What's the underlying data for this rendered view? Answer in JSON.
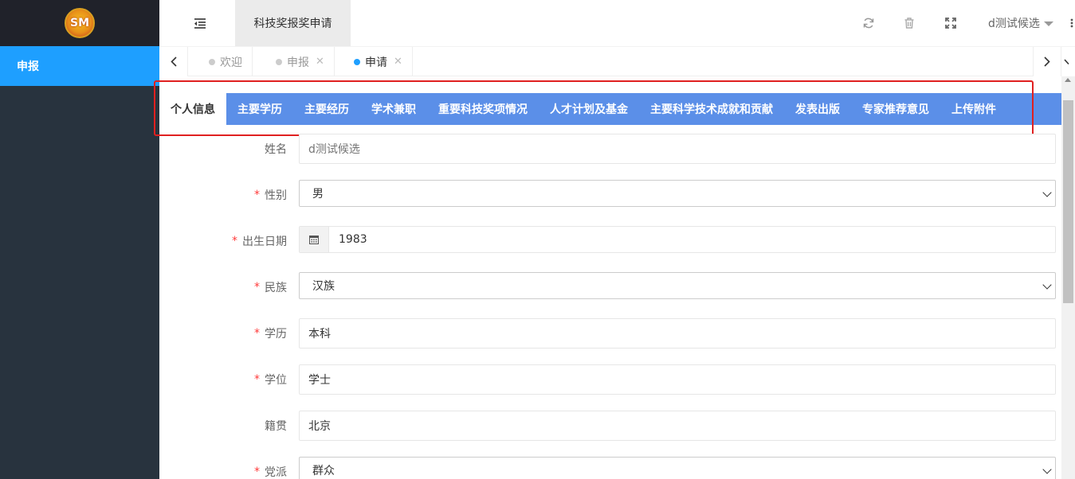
{
  "sidebar": {
    "logo_text": "SM",
    "items": [
      {
        "label": "申报"
      }
    ]
  },
  "header": {
    "title": "科技奖报奖申请",
    "user_name": "d测试候选",
    "icons": [
      "menu-fold-icon",
      "refresh-icon",
      "trash-icon",
      "fullscreen-icon",
      "more-vertical-icon"
    ]
  },
  "tabbar": {
    "tabs": [
      {
        "label": "欢迎",
        "closable": false,
        "active": false
      },
      {
        "label": "申报",
        "closable": true,
        "active": false
      },
      {
        "label": "申请",
        "closable": true,
        "active": true
      }
    ]
  },
  "content_tabs": [
    {
      "label": "个人信息",
      "active": true
    },
    {
      "label": "主要学历"
    },
    {
      "label": "主要经历"
    },
    {
      "label": "学术兼职"
    },
    {
      "label": "重要科技奖项情况"
    },
    {
      "label": "人才计划及基金"
    },
    {
      "label": "主要科学技术成就和贡献"
    },
    {
      "label": "发表出版"
    },
    {
      "label": "专家推荐意见"
    },
    {
      "label": "上传附件"
    }
  ],
  "form": {
    "name": {
      "label": "姓名",
      "required": false,
      "placeholder": "d测试候选"
    },
    "gender": {
      "label": "性别",
      "required": true,
      "value": "男"
    },
    "birth_date": {
      "label": "出生日期",
      "required": true,
      "value": "1983"
    },
    "ethnicity": {
      "label": "民族",
      "required": true,
      "value": "汉族"
    },
    "education": {
      "label": "学历",
      "required": true,
      "value": "本科"
    },
    "degree": {
      "label": "学位",
      "required": true,
      "value": "学士"
    },
    "native_place": {
      "label": "籍贯",
      "required": false,
      "value": "北京"
    },
    "party": {
      "label": "党派",
      "required": true,
      "value": "群众"
    }
  },
  "required_mark": "*",
  "colors": {
    "sidebar_bg": "#28333e",
    "accent": "#1e9fff",
    "content_tab_bg": "#5b8fe8",
    "highlight_border": "#e02020",
    "required": "#ff3b3b"
  }
}
